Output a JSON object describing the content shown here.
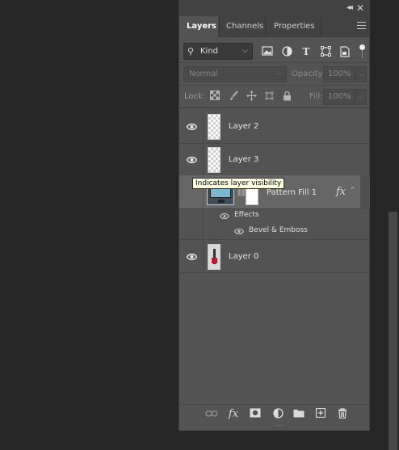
{
  "panel": {
    "collapse_icon": "double-chevron-right-icon",
    "close_icon": "close-icon"
  },
  "tabs": [
    {
      "label": "Layers",
      "active": true
    },
    {
      "label": "Channels",
      "active": false
    },
    {
      "label": "Properties",
      "active": false
    }
  ],
  "filter": {
    "kind_label": "Kind",
    "icons": [
      "pixel-layer-filter-icon",
      "adjustment-layer-filter-icon",
      "type-layer-filter-icon",
      "shape-layer-filter-icon",
      "smart-object-filter-icon"
    ]
  },
  "blend": {
    "mode": "Normal",
    "opacity_label": "Opacity:",
    "opacity_value": "100%"
  },
  "lock": {
    "label": "Lock:",
    "fill_label": "Fill:",
    "fill_value": "100%"
  },
  "layers": [
    {
      "name": "Layer 2",
      "visible": true
    },
    {
      "name": "Layer 3",
      "visible": true
    },
    {
      "name": "Pattern Fill 1",
      "visible": false,
      "selected": true,
      "fx": "fx",
      "effects_label": "Effects",
      "effect_items": [
        "Bevel & Emboss"
      ]
    },
    {
      "name": "Layer 0",
      "visible": true
    }
  ],
  "tooltip": "Indicates layer visibility",
  "bottom_icons": [
    "link-layers-icon",
    "add-layer-style-icon",
    "add-mask-icon",
    "new-fill-adjustment-icon",
    "new-group-icon",
    "new-layer-icon",
    "delete-layer-icon"
  ],
  "bottom_fx": "fx",
  "colors": {
    "panel_bg": "#535353",
    "selected_row": "#666666",
    "tooltip_bg": "#ffffe1",
    "app_bg": "#262626"
  }
}
